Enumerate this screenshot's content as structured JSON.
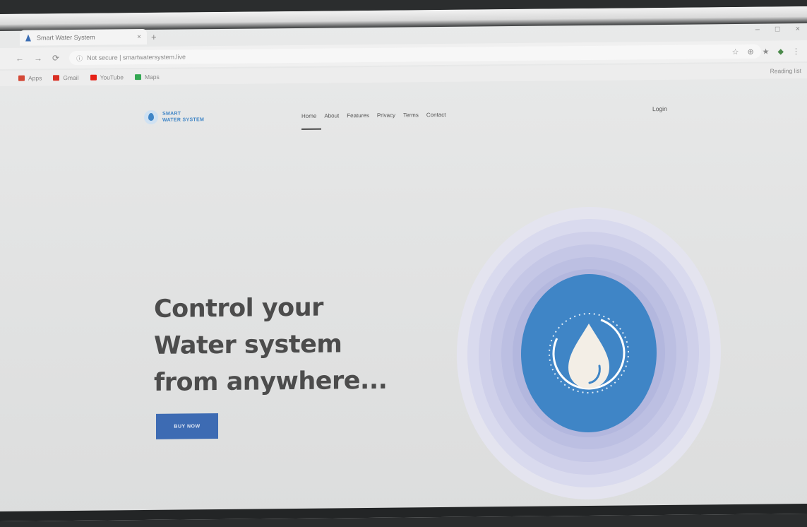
{
  "browser": {
    "tab_title": "Smart Water System",
    "tab_close": "×",
    "new_tab": "+",
    "window_controls": [
      "–",
      "□",
      "×"
    ],
    "nav_buttons": [
      "←",
      "→",
      "⟳"
    ],
    "address": "Not secure | smartwatersystem.live",
    "toolbar_icons": [
      "☆",
      "⊕",
      "★",
      "◆",
      "⋮"
    ],
    "bookmarks": [
      {
        "label": "Apps",
        "color": "#d34836"
      },
      {
        "label": "Gmail",
        "color": "#d93025"
      },
      {
        "label": "YouTube",
        "color": "#e62117"
      },
      {
        "label": "Maps",
        "color": "#34a853"
      }
    ],
    "reading_list": "Reading list"
  },
  "site": {
    "logo_line1": "SMART",
    "logo_line2": "WATER SYSTEM",
    "menu": [
      "Home",
      "About",
      "Features",
      "Privacy",
      "Terms",
      "Contact"
    ],
    "login": "Login",
    "hero_lines": [
      "Control your",
      "Water system",
      "from anywhere..."
    ],
    "buy_button": "BUY NOW"
  },
  "colors": {
    "accent": "#3d6bb3",
    "circle_blue": "#3f85c6",
    "ring_lavender": "#b9bce3",
    "title_text": "#4c4c4c"
  },
  "icons": {
    "graphic": "water-drop-icon",
    "gauge": "gauge-ring-icon"
  }
}
